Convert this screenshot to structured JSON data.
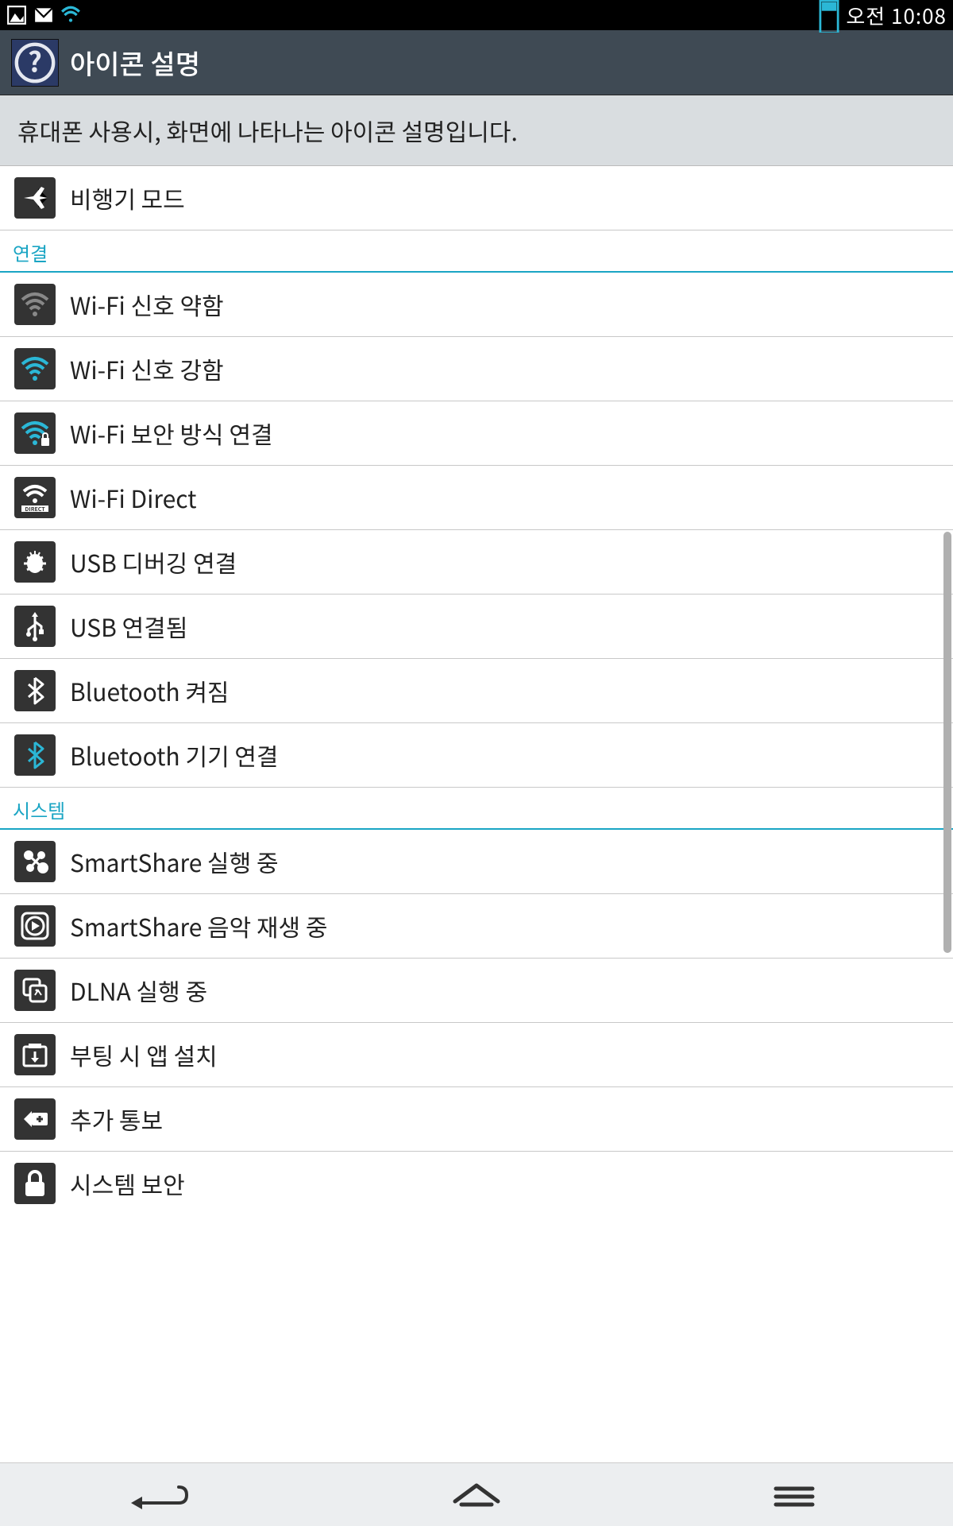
{
  "status_bar": {
    "time": "오전 10:08"
  },
  "app_bar": {
    "title": "아이콘 설명"
  },
  "description": "휴대폰 사용시, 화면에 나타나는 아이콘 설명입니다.",
  "top_item": {
    "label": "비행기 모드",
    "icon": "airplane-icon"
  },
  "sections": [
    {
      "header": "연결",
      "items": [
        {
          "label": "Wi-Fi 신호 약함",
          "icon": "wifi-weak-icon"
        },
        {
          "label": "Wi-Fi 신호 강함",
          "icon": "wifi-strong-icon"
        },
        {
          "label": "Wi-Fi 보안 방식 연결",
          "icon": "wifi-secure-icon"
        },
        {
          "label": "Wi-Fi Direct",
          "icon": "wifi-direct-icon"
        },
        {
          "label": "USB 디버깅 연결",
          "icon": "usb-debug-icon"
        },
        {
          "label": "USB 연결됨",
          "icon": "usb-connected-icon"
        },
        {
          "label": "Bluetooth 켜짐",
          "icon": "bluetooth-on-icon"
        },
        {
          "label": "Bluetooth 기기 연결",
          "icon": "bluetooth-connected-icon"
        }
      ]
    },
    {
      "header": "시스템",
      "items": [
        {
          "label": "SmartShare 실행 중",
          "icon": "smartshare-icon"
        },
        {
          "label": "SmartShare 음악 재생 중",
          "icon": "smartshare-play-icon"
        },
        {
          "label": "DLNA 실행 중",
          "icon": "dlna-icon"
        },
        {
          "label": "부팅 시 앱 설치",
          "icon": "boot-install-icon"
        },
        {
          "label": "추가 통보",
          "icon": "more-notification-icon"
        },
        {
          "label": "시스템 보안",
          "icon": "system-security-icon"
        }
      ]
    }
  ]
}
